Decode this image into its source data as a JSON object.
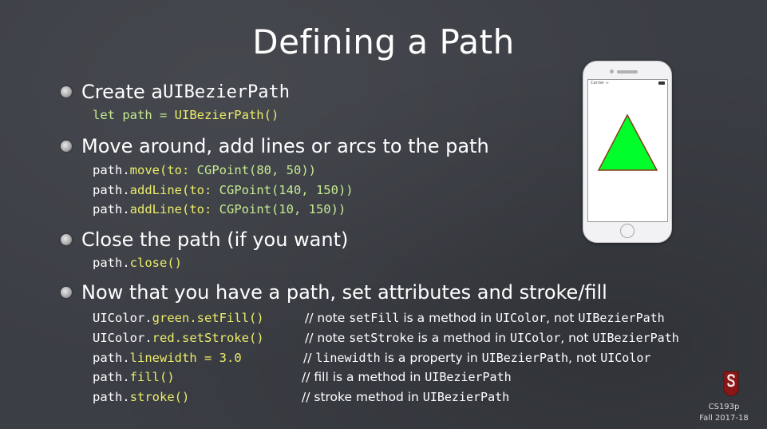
{
  "title": "Defining a Path",
  "bullets": [
    {
      "text_pre": "Create a ",
      "text_mono": "UIBezierPath"
    },
    {
      "text": "Move around, add lines or arcs to the path"
    },
    {
      "text": "Close the path (if you want)"
    },
    {
      "text": "Now that you have a path, set attributes and stroke/fill"
    }
  ],
  "code": {
    "create": {
      "kw": "let path = ",
      "call": "UIBezierPath()"
    },
    "move": {
      "obj": "path.",
      "method": "move(to: ",
      "arg": "CGPoint(80, 50))"
    },
    "line1": {
      "obj": "path.",
      "method": "addLine(to: ",
      "arg": "CGPoint(140, 150))"
    },
    "line2": {
      "obj": "path.",
      "method": "addLine(to: ",
      "arg": "CGPoint(10, 150))"
    },
    "close": {
      "obj": "path.",
      "method": "close()"
    },
    "set_fill": {
      "obj": "UIColor.",
      "method": "green.setFill()"
    },
    "set_stroke": {
      "obj": "UIColor.",
      "method": "red.setStroke()"
    },
    "linewidth": {
      "obj": "path.",
      "method": "linewidth = 3.0"
    },
    "fill": {
      "obj": "path.",
      "method": "fill()"
    },
    "stroke": {
      "obj": "path.",
      "method": "stroke()"
    }
  },
  "comments": {
    "set_fill": {
      "a": "// note ",
      "b": "setFill",
      "c": " is a method in ",
      "d": "UIColor",
      "e": ", not ",
      "f": "UIBezierPath"
    },
    "set_stroke": {
      "a": "// note ",
      "b": "setStroke",
      "c": " is a method in ",
      "d": "UIColor",
      "e": ", not ",
      "f": "UIBezierPath"
    },
    "linewidth": {
      "a": "// ",
      "b": "linewidth",
      "c": " is a property in ",
      "d": "UIBezierPath",
      "e": ", not ",
      "f": "UIColor"
    },
    "fill": {
      "a": "// ",
      "b": "fill",
      "c": " is a method in ",
      "d": "UIBezierPath"
    },
    "stroke": {
      "a": "// ",
      "b": "stroke",
      "c": " method in ",
      "d": "UIBezierPath"
    }
  },
  "phone": {
    "status": "Carrier ≈",
    "triangle": {
      "fill": "#00ff2a",
      "stroke": "#8a3a1a"
    }
  },
  "footer": {
    "course": "CS193p",
    "term": "Fall 2017-18"
  },
  "colors": {
    "background": "#3b3e44",
    "code_yellow": "#ecec6a",
    "code_green": "#c6eb93"
  }
}
